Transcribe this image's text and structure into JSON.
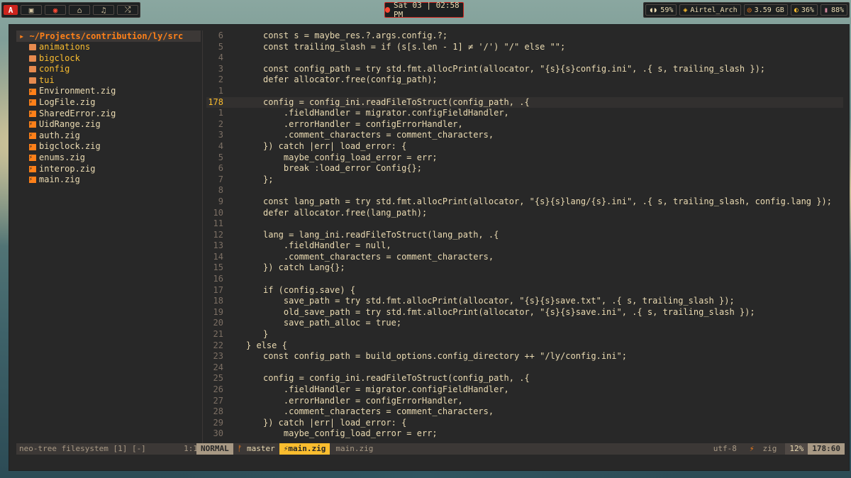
{
  "topbar": {
    "workspaces": [
      {
        "icon": "arch-logo-icon",
        "glyph": "A"
      },
      {
        "icon": "terminal-icon",
        "glyph": "▣"
      },
      {
        "icon": "browser-icon",
        "glyph": "◉"
      },
      {
        "icon": "discord-icon",
        "glyph": "⌂"
      },
      {
        "icon": "music-icon",
        "glyph": "♫"
      },
      {
        "icon": "shuffle-icon",
        "glyph": "⤮"
      }
    ],
    "clock": "Sat 03 | 02:58 PM",
    "stats": [
      {
        "icon": "headphones-icon",
        "glyph": "🎧",
        "value": "59%"
      },
      {
        "icon": "wifi-icon",
        "glyph": "◈",
        "value": "Airtel_Arch"
      },
      {
        "icon": "memory-icon",
        "glyph": "◎",
        "value": "3.59 GB"
      },
      {
        "icon": "brightness-icon",
        "glyph": "◐",
        "value": "36%"
      },
      {
        "icon": "battery-icon",
        "glyph": "▮",
        "value": "88%"
      }
    ]
  },
  "tree": {
    "root": "~/Projects/contribution/ly/src",
    "folders": [
      "animations",
      "bigclock",
      "config",
      "tui"
    ],
    "files": [
      "Environment.zig",
      "LogFile.zig",
      "SharedError.zig",
      "UidRange.zig",
      "auth.zig",
      "bigclock.zig",
      "enums.zig",
      "interop.zig",
      "main.zig"
    ]
  },
  "editor": {
    "lines": [
      {
        "n": "6",
        "text": "const s = maybe_res.?.args.config.?;"
      },
      {
        "n": "5",
        "text": "const trailing_slash = if (s[s.len - 1] ≠ '/') \"/\" else \"\";"
      },
      {
        "n": "4",
        "text": ""
      },
      {
        "n": "3",
        "text": "const config_path = try std.fmt.allocPrint(allocator, \"{s}{s}config.ini\", .{ s, trailing_slash });"
      },
      {
        "n": "2",
        "text": "defer allocator.free(config_path);"
      },
      {
        "n": "1",
        "text": ""
      },
      {
        "n": "178",
        "text": "config = config_ini.readFileToStruct(config_path, .{",
        "cur": true
      },
      {
        "n": "1",
        "text": "    .fieldHandler = migrator.configFieldHandler,"
      },
      {
        "n": "2",
        "text": "    .errorHandler = configErrorHandler,"
      },
      {
        "n": "3",
        "text": "    .comment_characters = comment_characters,"
      },
      {
        "n": "4",
        "text": "}) catch |err| load_error: {"
      },
      {
        "n": "5",
        "text": "    maybe_config_load_error = err;"
      },
      {
        "n": "6",
        "text": "    break :load_error Config{};"
      },
      {
        "n": "7",
        "text": "};"
      },
      {
        "n": "8",
        "text": ""
      },
      {
        "n": "9",
        "text": "const lang_path = try std.fmt.allocPrint(allocator, \"{s}{s}lang/{s}.ini\", .{ s, trailing_slash, config.lang });"
      },
      {
        "n": "10",
        "text": "defer allocator.free(lang_path);"
      },
      {
        "n": "11",
        "text": ""
      },
      {
        "n": "12",
        "text": "lang = lang_ini.readFileToStruct(lang_path, .{"
      },
      {
        "n": "13",
        "text": "    .fieldHandler = null,"
      },
      {
        "n": "14",
        "text": "    .comment_characters = comment_characters,"
      },
      {
        "n": "15",
        "text": "}) catch Lang{};"
      },
      {
        "n": "16",
        "text": ""
      },
      {
        "n": "17",
        "text": "if (config.save) {"
      },
      {
        "n": "18",
        "text": "    save_path = try std.fmt.allocPrint(allocator, \"{s}{s}save.txt\", .{ s, trailing_slash });"
      },
      {
        "n": "19",
        "text": "    old_save_path = try std.fmt.allocPrint(allocator, \"{s}{s}save.ini\", .{ s, trailing_slash });"
      },
      {
        "n": "20",
        "text": "    save_path_alloc = true;"
      },
      {
        "n": "21",
        "text": "}"
      },
      {
        "n": "22",
        "text": "} else {",
        "indent": -1
      },
      {
        "n": "23",
        "text": "const config_path = build_options.config_directory ++ \"/ly/config.ini\";"
      },
      {
        "n": "24",
        "text": ""
      },
      {
        "n": "25",
        "text": "config = config_ini.readFileToStruct(config_path, .{"
      },
      {
        "n": "26",
        "text": "    .fieldHandler = migrator.configFieldHandler,"
      },
      {
        "n": "27",
        "text": "    .errorHandler = configErrorHandler,"
      },
      {
        "n": "28",
        "text": "    .comment_characters = comment_characters,"
      },
      {
        "n": "29",
        "text": "}) catch |err| load_error: {"
      },
      {
        "n": "30",
        "text": "    maybe_config_load_error = err;"
      }
    ]
  },
  "status_left": {
    "label": "neo-tree filesystem [1] [-]",
    "pos": "1:1"
  },
  "status_right": {
    "mode": "NORMAL",
    "branch": "master",
    "active_file": "main.zig",
    "inactive_file": "main.zig",
    "encoding": "utf-8",
    "filetype": "zig",
    "percent": "12%",
    "cursor": "178:60"
  }
}
